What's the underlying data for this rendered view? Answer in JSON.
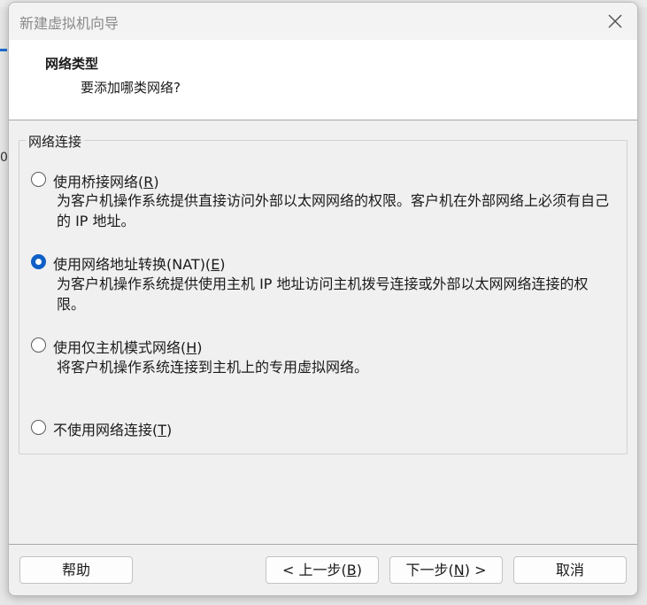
{
  "window": {
    "title": "新建虚拟机向导"
  },
  "header": {
    "title": "网络类型",
    "subtitle": "要添加哪类网络?"
  },
  "network_group": {
    "label": "网络连接",
    "options": [
      {
        "label_pre": "使用桥接网络(",
        "mnemonic": "R",
        "label_post": ")",
        "checked": false,
        "description": "为客户机操作系统提供直接访问外部以太网网络的权限。客户机在外部网络上必须有自己的 IP 地址。"
      },
      {
        "label_pre": "使用网络地址转换(NAT)(",
        "mnemonic": "E",
        "label_post": ")",
        "checked": true,
        "description": "为客户机操作系统提供使用主机 IP 地址访问主机拨号连接或外部以太网网络连接的权限。"
      },
      {
        "label_pre": "使用仅主机模式网络(",
        "mnemonic": "H",
        "label_post": ")",
        "checked": false,
        "description": "将客户机操作系统连接到主机上的专用虚拟网络。"
      },
      {
        "label_pre": "不使用网络连接(",
        "mnemonic": "T",
        "label_post": ")",
        "checked": false,
        "description": ""
      }
    ]
  },
  "buttons": {
    "help": "帮助",
    "back_pre": "< 上一步(",
    "back_mnemonic": "B",
    "back_post": ")",
    "next_pre": "下一步(",
    "next_mnemonic": "N",
    "next_post": ") >",
    "cancel": "取消"
  },
  "background": {
    "left_text": "0"
  },
  "colors": {
    "accent": "#0f5fc6",
    "dialog_bg": "#f0f0f0",
    "header_bg": "#ffffff"
  }
}
